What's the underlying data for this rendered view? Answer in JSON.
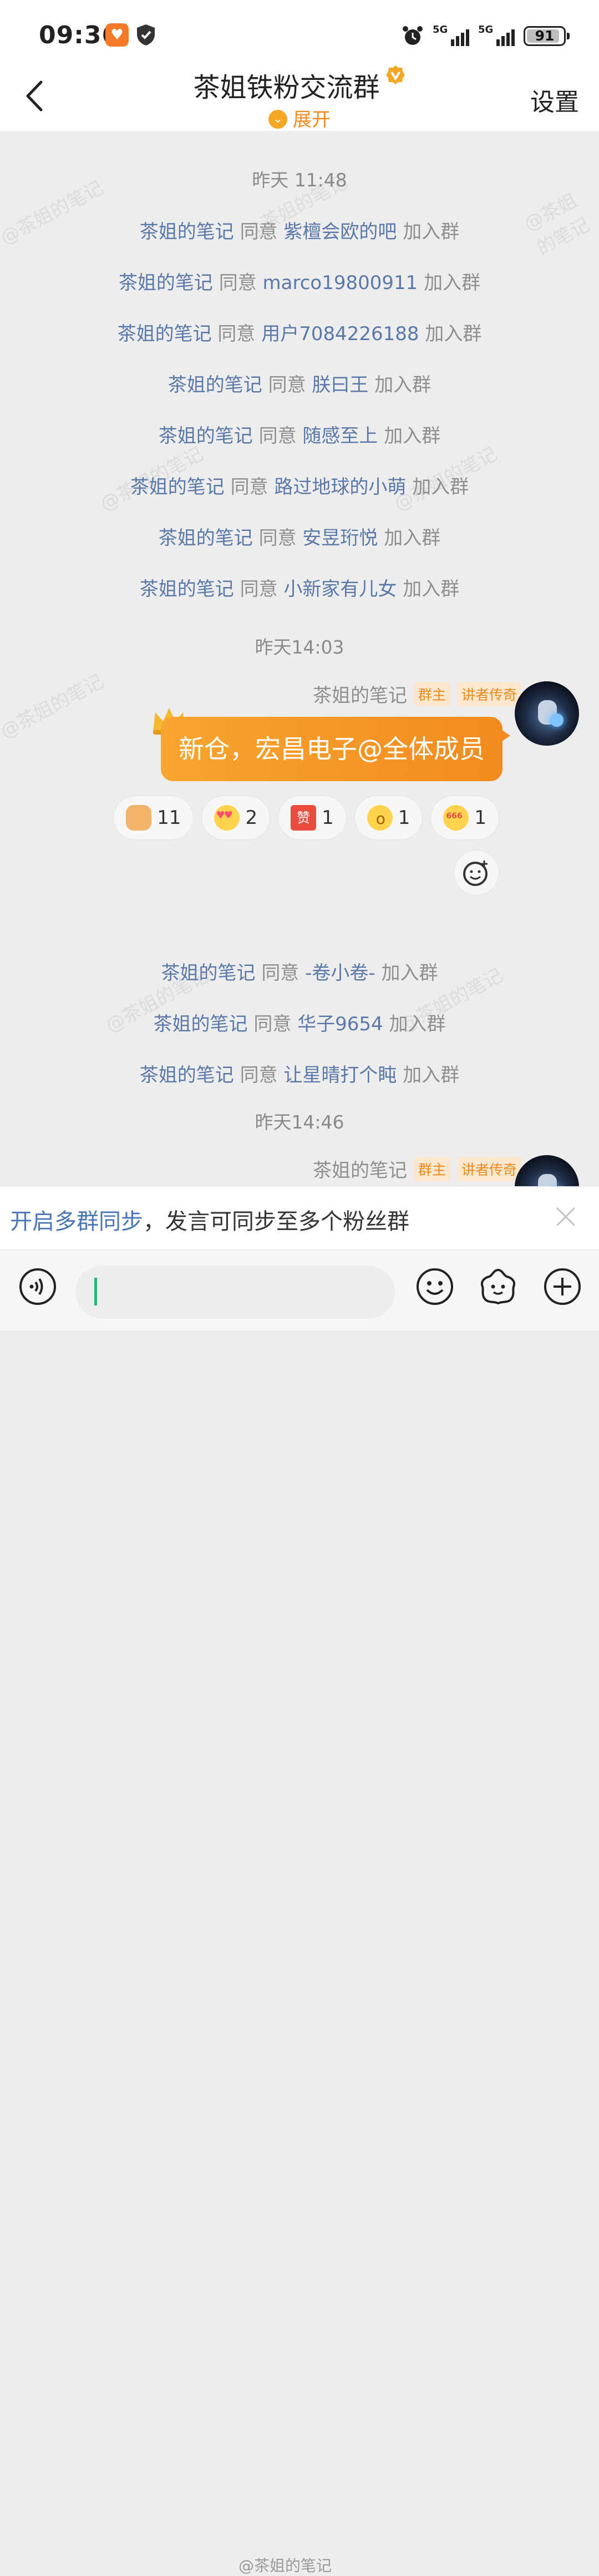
{
  "status_bar": {
    "time": "09:36",
    "signal1": "5G",
    "signal2": "5G",
    "battery": "91",
    "battery_level": 0.91
  },
  "header": {
    "title": "茶姐铁粉交流群",
    "expand_label": "展开",
    "settings_label": "设置"
  },
  "watermark": "@茶姐的笔记",
  "chat": {
    "timestamps": [
      "昨天 11:48",
      "昨天14:03",
      "昨天14:46"
    ],
    "verb": "同意",
    "suffix": "加入群",
    "approver": "茶姐的笔记",
    "joins_block1": [
      "紫檀会欧的吧",
      "marco19800911",
      "用户7084226188",
      "朕曰王",
      "随感至上",
      "路过地球的小萌",
      "安昱珩悦",
      "小新家有儿女"
    ],
    "joins_block2": [
      "-卷小卷-",
      "华子9654",
      "让星晴打个盹"
    ],
    "message": {
      "sender": "茶姐的笔记",
      "tag_owner": "群主",
      "tag_title": "讲者传奇",
      "text": "新仓，宏昌电子@全体成员",
      "reactions": [
        {
          "icon": "thumbs-up",
          "count": "11"
        },
        {
          "icon": "heart-eyes",
          "count": "2"
        },
        {
          "icon": "zan",
          "label": "赞",
          "count": "1"
        },
        {
          "icon": "surprised",
          "count": "1"
        },
        {
          "icon": "666",
          "count": "1"
        }
      ]
    },
    "message2": {
      "sender": "茶姐的笔记",
      "tag_owner": "群主",
      "tag_title": "讲者传奇"
    }
  },
  "sync_banner": {
    "link_text": "开启多群同步",
    "text": "，发言可同步至多个粉丝群"
  },
  "input": {
    "value": "",
    "bottom_watermark": "@茶姐的笔记"
  },
  "colors": {
    "accent": "#f28b1e",
    "link": "#5a78a8"
  }
}
